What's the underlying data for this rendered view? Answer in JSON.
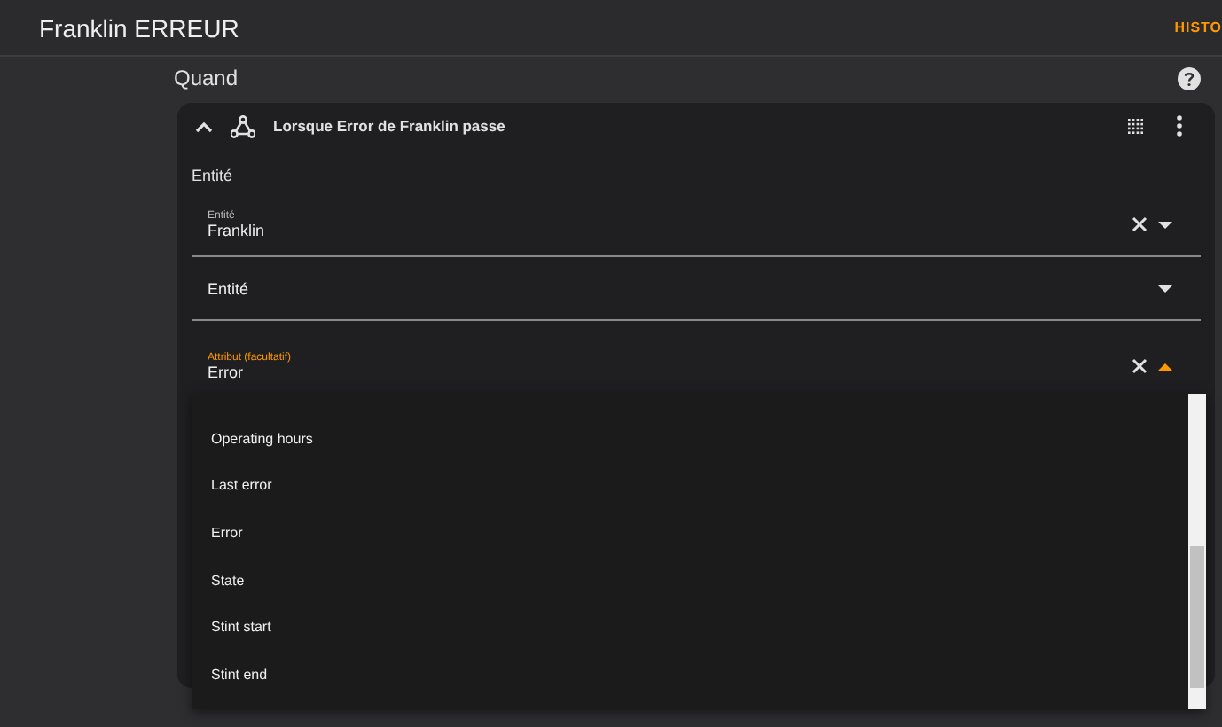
{
  "header": {
    "title": "Franklin ERREUR",
    "tab": "HISTO"
  },
  "section": {
    "title": "Quand"
  },
  "trigger": {
    "title": "Lorsque Error de Franklin passe",
    "group_label": "Entité",
    "fields": [
      {
        "label": "Entité",
        "value": "Franklin",
        "clearable": true,
        "open": false
      },
      {
        "placeholder": "Entité",
        "clearable": false,
        "open": false
      },
      {
        "label": "Attribut (facultatif)",
        "value": "Error",
        "clearable": true,
        "open": true
      }
    ]
  },
  "dropdown": {
    "items": [
      "Operating hours",
      "Last error",
      "Error",
      "State",
      "Stint start",
      "Stint end"
    ]
  }
}
